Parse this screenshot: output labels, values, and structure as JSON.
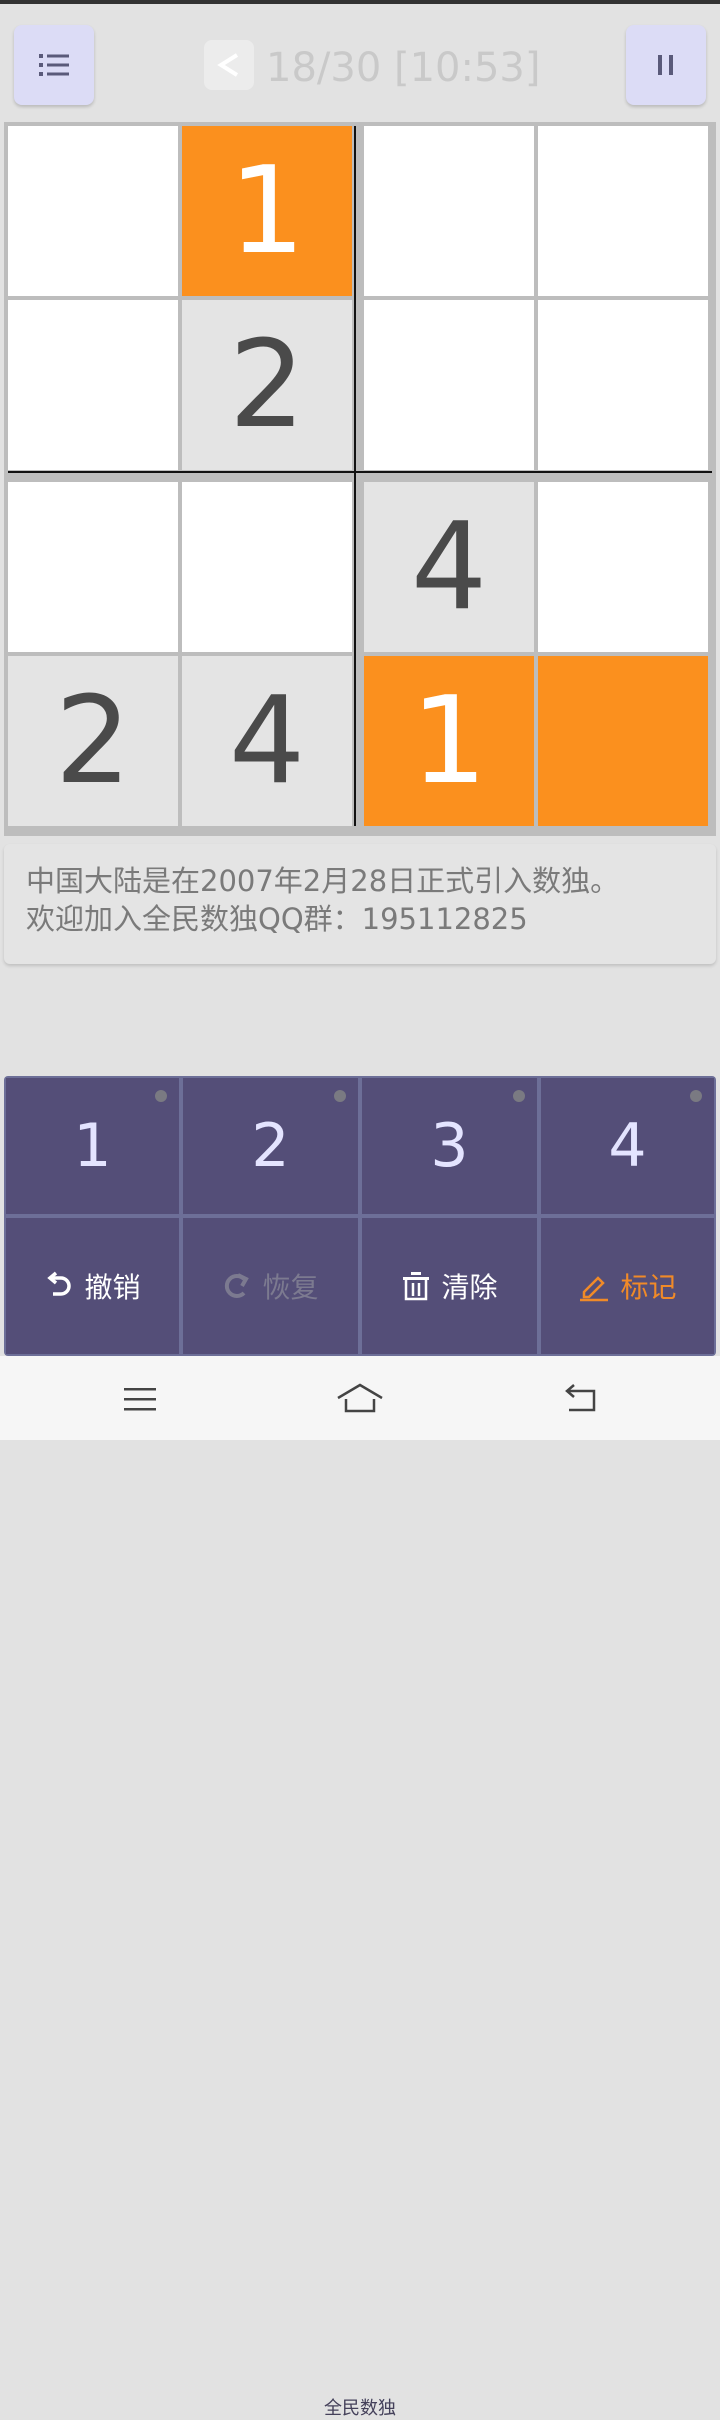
{
  "header": {
    "title": "18/30 [10:53]",
    "menu_icon": "list-icon",
    "back_icon": "chevron-left-icon",
    "pause_icon": "pause-icon"
  },
  "board": {
    "size": 4,
    "cells": [
      {
        "row": 0,
        "col": 0,
        "value": "",
        "state": "empty"
      },
      {
        "row": 0,
        "col": 1,
        "value": "1",
        "state": "highlight"
      },
      {
        "row": 0,
        "col": 2,
        "value": "",
        "state": "empty"
      },
      {
        "row": 0,
        "col": 3,
        "value": "",
        "state": "empty"
      },
      {
        "row": 1,
        "col": 0,
        "value": "",
        "state": "empty"
      },
      {
        "row": 1,
        "col": 1,
        "value": "2",
        "state": "given"
      },
      {
        "row": 1,
        "col": 2,
        "value": "",
        "state": "empty"
      },
      {
        "row": 1,
        "col": 3,
        "value": "",
        "state": "empty"
      },
      {
        "row": 2,
        "col": 0,
        "value": "",
        "state": "empty"
      },
      {
        "row": 2,
        "col": 1,
        "value": "",
        "state": "empty"
      },
      {
        "row": 2,
        "col": 2,
        "value": "4",
        "state": "given"
      },
      {
        "row": 2,
        "col": 3,
        "value": "",
        "state": "empty"
      },
      {
        "row": 3,
        "col": 0,
        "value": "2",
        "state": "given"
      },
      {
        "row": 3,
        "col": 1,
        "value": "4",
        "state": "given"
      },
      {
        "row": 3,
        "col": 2,
        "value": "1",
        "state": "highlight"
      },
      {
        "row": 3,
        "col": 3,
        "value": "",
        "state": "highlight"
      }
    ]
  },
  "info": {
    "line1": "中国大陆是在2007年2月28日正式引入数独。",
    "line2": "欢迎加入全民数独QQ群：195112825"
  },
  "keypad": {
    "numbers": [
      "1",
      "2",
      "3",
      "4"
    ],
    "actions": [
      {
        "label": "撤销",
        "icon": "undo-icon",
        "enabled": true
      },
      {
        "label": "恢复",
        "icon": "redo-icon",
        "enabled": false
      },
      {
        "label": "清除",
        "icon": "trash-icon",
        "enabled": true
      },
      {
        "label": "标记",
        "icon": "pencil-icon",
        "enabled": true
      }
    ],
    "watermark": "全民数独"
  },
  "navbar": {
    "icons": [
      "menu-icon",
      "home-icon",
      "back-icon"
    ]
  },
  "colors": {
    "highlight": "#fb901e",
    "keypad_bg": "#544e78",
    "mark": "#f08a28"
  }
}
